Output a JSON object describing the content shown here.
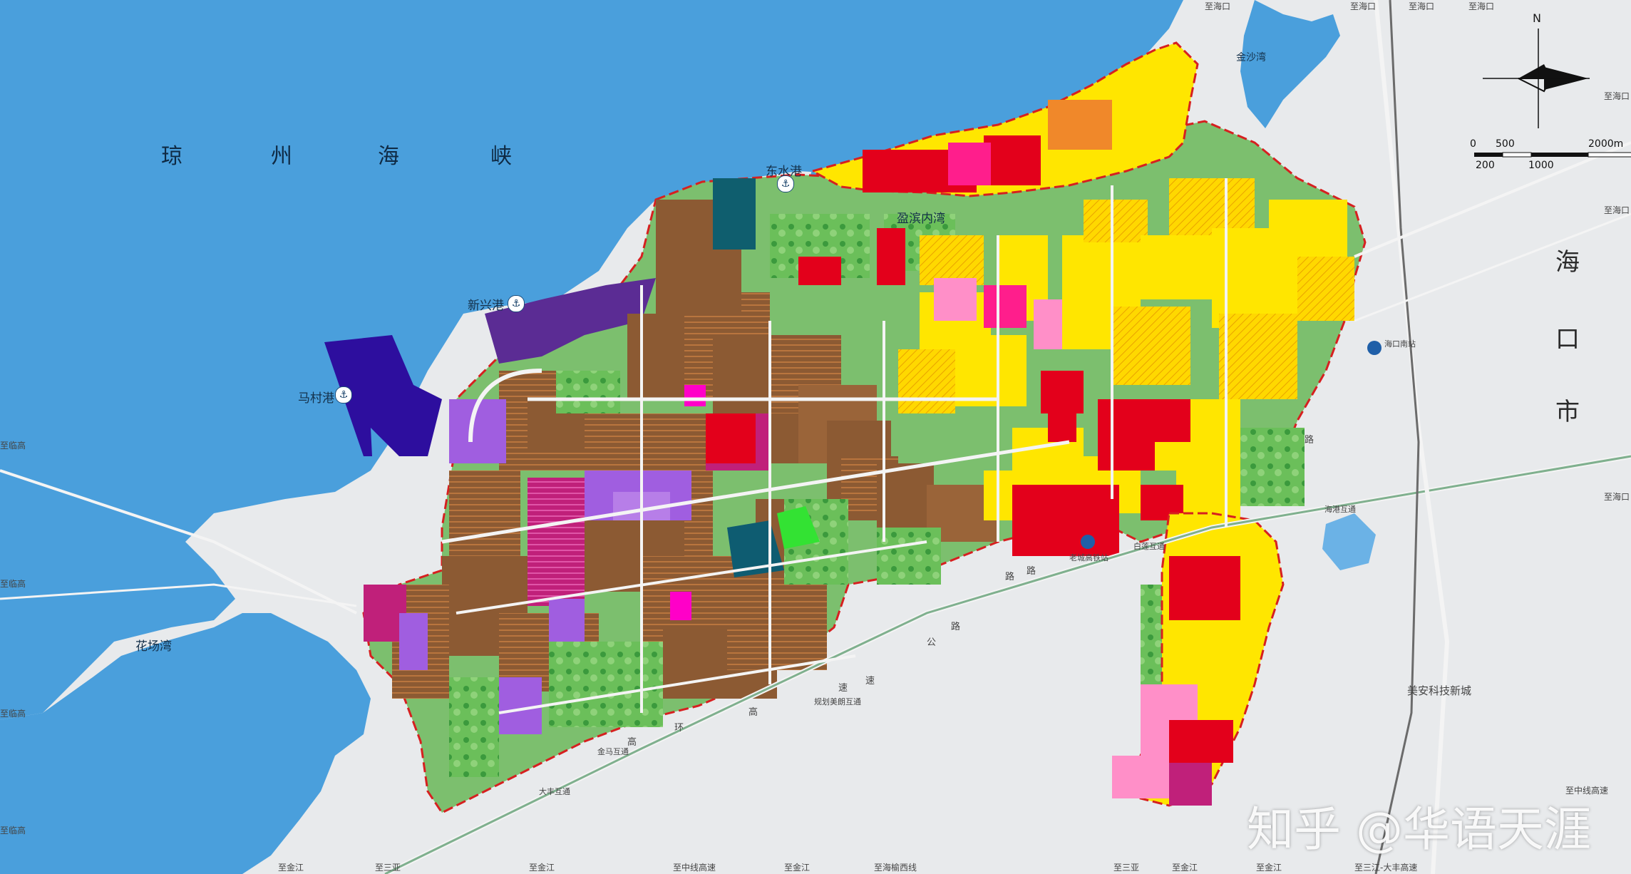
{
  "water_labels": {
    "strait": [
      "琼",
      "州",
      "海",
      "峡"
    ],
    "inner_bay": "盈滨内湾",
    "flower_bay": "花场湾",
    "jinsha_bay": "金沙湾"
  },
  "ports": {
    "dongshui": "东水港",
    "xinxing": "新兴港",
    "macun": "马村港"
  },
  "city": {
    "name_chars": [
      "海",
      "口",
      "市"
    ],
    "meian": "美安科技新城"
  },
  "stations": {
    "haikou_south": "海口南站",
    "laocheng": "老城高铁站"
  },
  "interchanges": {
    "dafeng": "大丰互通",
    "jinma": "金马互通",
    "meiliang": "规划美朗互通",
    "bailian": "白莲互通",
    "haigang": "海港互通"
  },
  "road_chars": [
    "路",
    "路",
    "速",
    "高",
    "环",
    "高",
    "速",
    "公",
    "路",
    "路"
  ],
  "destinations": {
    "top": [
      "至海口",
      "至海口",
      "至海口",
      "至海口"
    ],
    "left": [
      "至临高",
      "至临高",
      "至临高",
      "至临高"
    ],
    "right": [
      "至海口",
      "至海口",
      "至海口"
    ],
    "bottom": [
      "至金江",
      "至三亚",
      "至金江",
      "至中线高速",
      "至金江",
      "至海榆西线",
      "至三亚",
      "至金江",
      "至金江",
      "至三江-大丰高速",
      "至中线高速"
    ]
  },
  "scale_bar": {
    "top": [
      "0",
      "500",
      "2000m"
    ],
    "bottom": [
      "200",
      "1000"
    ]
  },
  "compass_letter": "N",
  "watermark": "知乎 @华语天涯",
  "colors": {
    "sea": "#4a9fdc",
    "land": "#e8eaec",
    "industrial": "#8c5a33",
    "residential": "#ffec00",
    "commercial": "#e3001b",
    "green": "#3cb04a",
    "purple": "#9b59d6",
    "navy": "#2d0e9e",
    "magenta": "#d6008c",
    "pink": "#ff8fc8",
    "orange": "#f0882a",
    "boundary": "#d62020"
  }
}
